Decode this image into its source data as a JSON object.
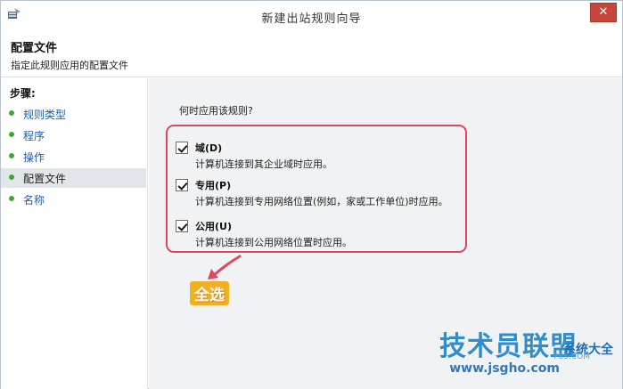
{
  "window": {
    "title": "新建出站规则向导",
    "close_label": "✕"
  },
  "header": {
    "title": "配置文件",
    "subtitle": "指定此规则应用的配置文件"
  },
  "sidebar": {
    "steps_label": "步骤:",
    "items": [
      {
        "label": "规则类型"
      },
      {
        "label": "程序"
      },
      {
        "label": "操作"
      },
      {
        "label": "配置文件",
        "active": true
      },
      {
        "label": "名称"
      }
    ]
  },
  "main": {
    "question": "何时应用该规则?",
    "options": [
      {
        "label": "域(D)",
        "description": "计算机连接到其企业域时应用。",
        "checked": true
      },
      {
        "label": "专用(P)",
        "description": "计算机连接到专用网络位置(例如，家或工作单位)时应用。",
        "checked": true
      },
      {
        "label": "公用(U)",
        "description": "计算机连接到公用网络位置时应用。",
        "checked": true
      }
    ],
    "callout": "全选"
  },
  "watermark": {
    "main": "技术员联盟",
    "url": "www.jsgho.com",
    "side": "系统大全",
    "code": "P85.COM"
  },
  "colors": {
    "highlight_border": "#e0475d",
    "step_dot": "#3aaa35",
    "step_link": "#1e5fa8",
    "callout_bg": "#f0b020"
  }
}
